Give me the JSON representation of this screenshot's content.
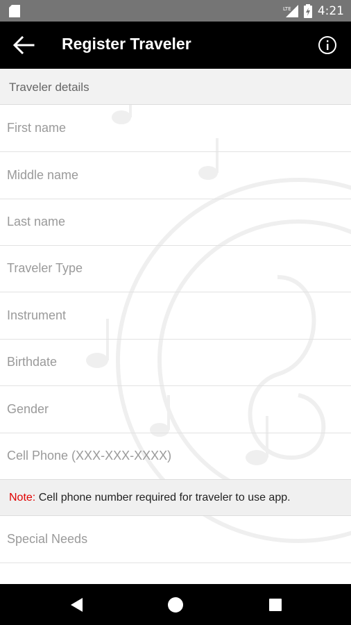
{
  "status_bar": {
    "time": "4:21",
    "network": "LTE",
    "icons": [
      "sd-card-icon",
      "signal-icon",
      "battery-charging-icon"
    ]
  },
  "app_bar": {
    "title": "Register Traveler",
    "icons": [
      "back-arrow-icon",
      "info-icon"
    ]
  },
  "form": {
    "section_title": "Traveler details",
    "fields": [
      {
        "name": "first-name",
        "placeholder": "First name",
        "value": ""
      },
      {
        "name": "middle-name",
        "placeholder": "Middle name",
        "value": ""
      },
      {
        "name": "last-name",
        "placeholder": "Last name",
        "value": ""
      },
      {
        "name": "traveler-type",
        "placeholder": "Traveler Type",
        "value": ""
      },
      {
        "name": "instrument",
        "placeholder": "Instrument",
        "value": ""
      },
      {
        "name": "birthdate",
        "placeholder": "Birthdate",
        "value": ""
      },
      {
        "name": "gender",
        "placeholder": "Gender",
        "value": ""
      },
      {
        "name": "cell-phone",
        "placeholder": "Cell Phone (XXX-XXX-XXXX)",
        "value": ""
      }
    ],
    "note_label": "Note:",
    "note_text": " Cell phone number required for traveler to use app.",
    "extra_fields": [
      {
        "name": "special-needs",
        "placeholder": "Special Needs",
        "value": ""
      }
    ]
  },
  "nav_bar": {
    "icons": [
      "nav-back-icon",
      "nav-home-icon",
      "nav-recents-icon"
    ]
  },
  "colors": {
    "app_bar": "#000000",
    "status_bar": "#757575",
    "note_accent": "#e00000",
    "section_bg": "#f2f2f2"
  }
}
